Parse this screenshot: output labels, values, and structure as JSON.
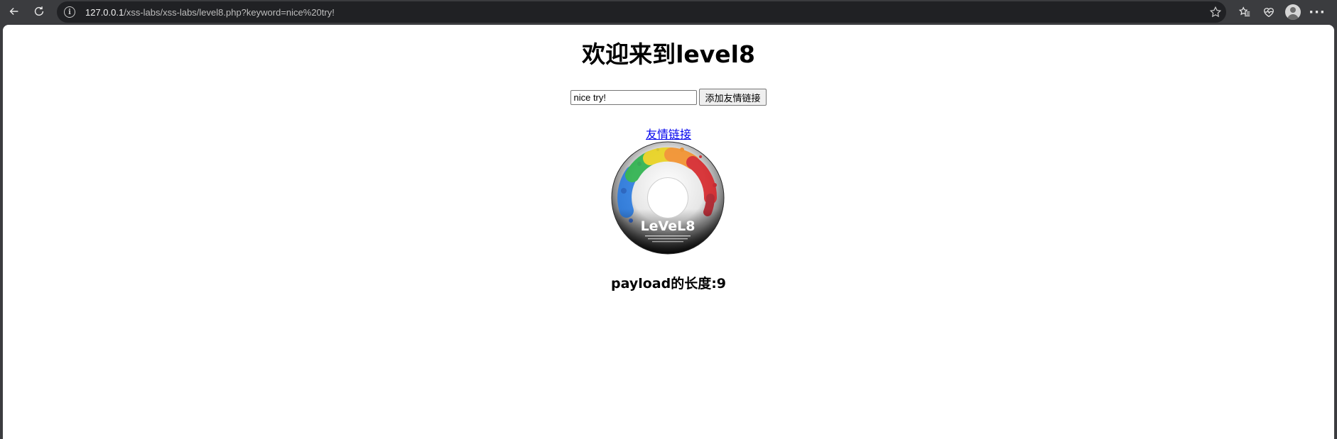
{
  "browser": {
    "url_host": "127.0.0.1",
    "url_path": "/xss-labs/xss-labs/level8.php?keyword=nice%20try!",
    "icons": [
      "back-icon",
      "reload-icon",
      "info-icon",
      "star-icon",
      "favorites-icon",
      "health-icon",
      "profile-avatar",
      "more-icon"
    ],
    "more_glyph": "···"
  },
  "page": {
    "title": "欢迎来到level8",
    "form": {
      "keyword_value": "nice try!",
      "submit_label": "添加友情链接"
    },
    "friend_link_label": "友情链接",
    "image": {
      "caption": "LeVeL8",
      "icon": "cd-disc-image"
    },
    "payload_length_text": "payload的长度:9"
  },
  "colors": {
    "chrome_bg": "#3b3c3f",
    "address_bg": "#202124",
    "link": "#0000ee"
  }
}
